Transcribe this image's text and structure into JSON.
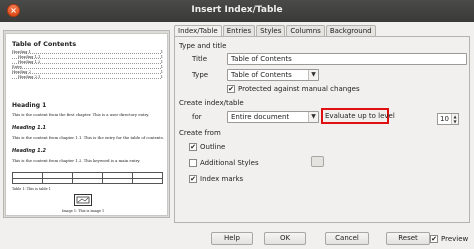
{
  "window": {
    "title": "Insert Index/Table"
  },
  "tabs": [
    "Index/Table",
    "Entries",
    "Styles",
    "Columns",
    "Background"
  ],
  "type_and_title": {
    "heading": "Type and title",
    "title_label": "Title",
    "title_value": "Table of Contents",
    "type_label": "Type",
    "type_value": "Table of Contents",
    "protected_label": "Protected against manual changes",
    "protected_checked": true
  },
  "create_index": {
    "heading": "Create index/table",
    "for_label": "for",
    "for_value": "Entire document",
    "evaluate_label": "Evaluate up to level",
    "evaluate_value": "10"
  },
  "create_from": {
    "heading": "Create from",
    "outline_label": "Outline",
    "outline_checked": true,
    "additional_styles_label": "Additional Styles",
    "additional_styles_checked": false,
    "index_marks_label": "Index marks",
    "index_marks_checked": true
  },
  "buttons": {
    "help": "Help",
    "ok": "OK",
    "cancel": "Cancel",
    "reset": "Reset",
    "preview_label": "Preview",
    "preview_checked": true
  },
  "preview_page": {
    "toc_title": "Table of Contents",
    "toc_lines": [
      "Heading 1",
      "Heading 1.1",
      "Heading 1.2",
      "Entry",
      "Heading 2",
      "Heading 2.1"
    ],
    "heading1": "Heading 1",
    "text1": "This is the content from the first chapter. This is a user directory entry.",
    "heading11": "Heading 1.1",
    "text11": "This is the content from chapter 1.1. This is the entry for the table of contents.",
    "heading12": "Heading 1.2",
    "text12": "This is the content from chapter 1.2. This keyword is a main entry.",
    "table_caption": "Table 1: This is table 1",
    "image_caption": "Image 1: This is image 1"
  },
  "colors": {
    "highlight": "#e01010",
    "titlebar": "#3d3d3b",
    "close": "#e45a25"
  }
}
